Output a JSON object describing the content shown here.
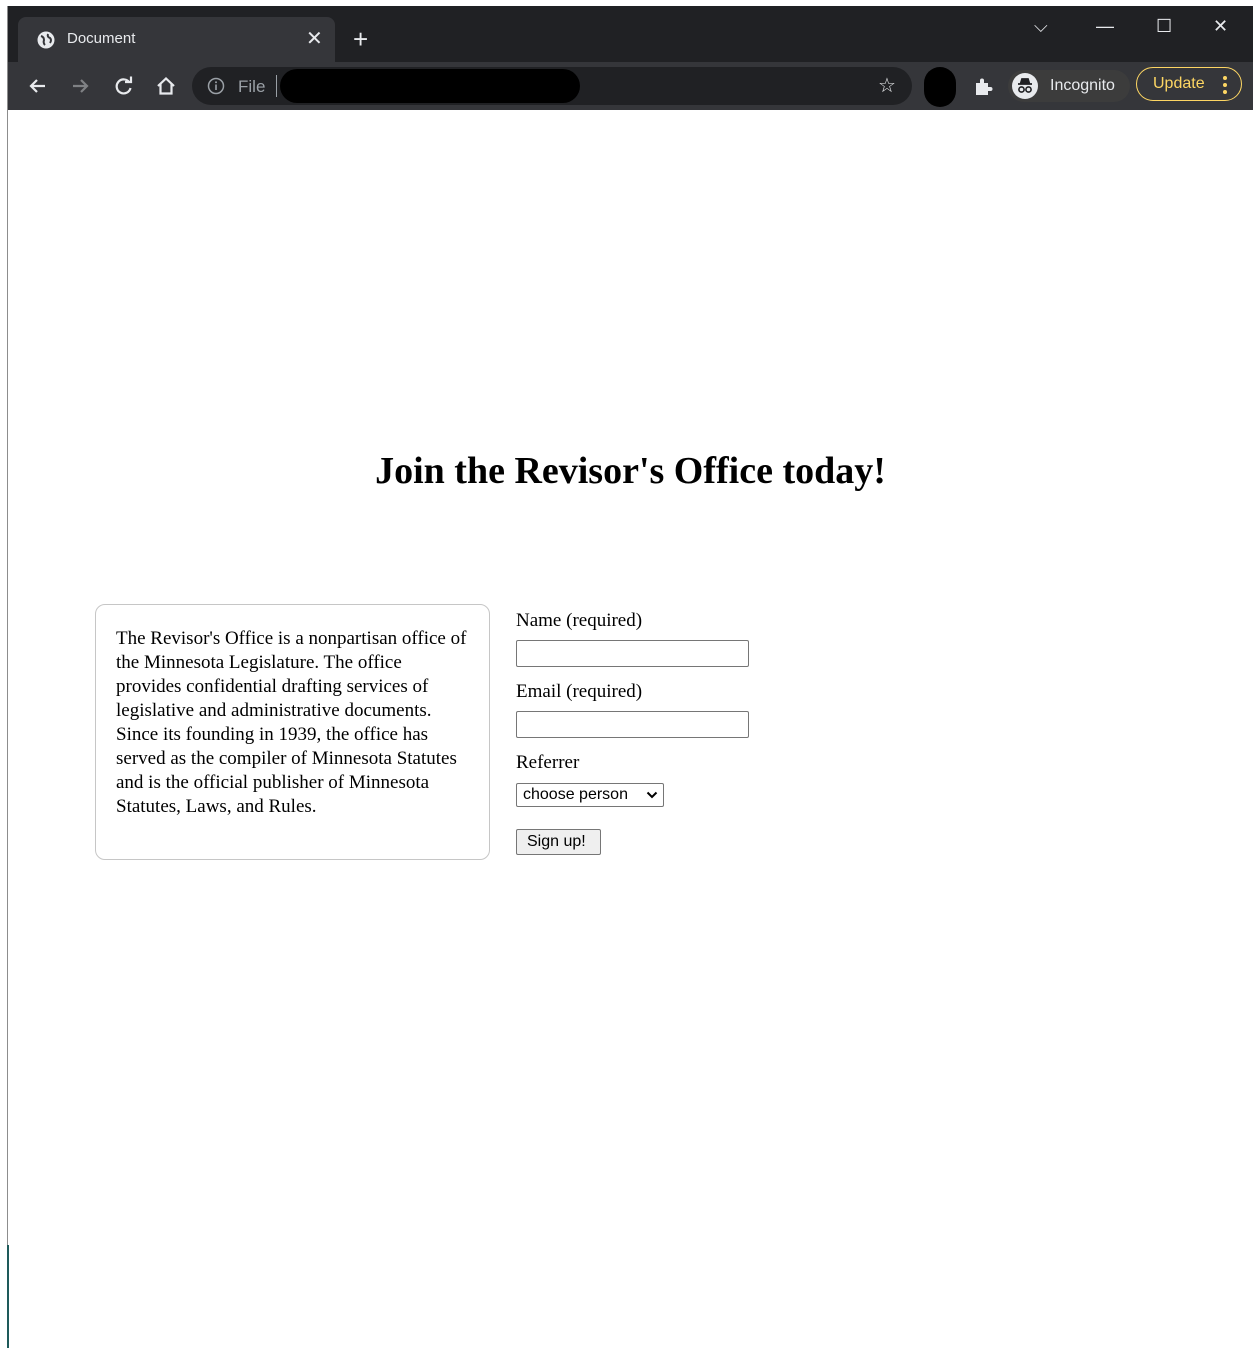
{
  "browser": {
    "tab_title": "Document",
    "tab_close": "✕",
    "new_tab": "+",
    "window_controls": {
      "tab_search": "⌵",
      "minimize": "—",
      "maximize": "☐",
      "close": "✕"
    },
    "address_scheme_label": "File",
    "bookmark_star": "☆",
    "incognito_label": "Incognito",
    "update_label": "Update",
    "colors": {
      "chrome_bg": "#202124",
      "toolbar_bg": "#35363a",
      "update_accent": "#fdd663"
    }
  },
  "page": {
    "heading": "Join the Revisor's Office today!",
    "info_text": "The Revisor's Office is a nonpartisan office of the Minnesota Legislature. The office provides confidential drafting services of legislative and administrative documents. Since its founding in 1939, the office has served as the compiler of Minnesota Statutes and is the official publisher of Minnesota Statutes, Laws, and Rules.",
    "form": {
      "name_label": "Name (required)",
      "name_value": "",
      "email_label": "Email (required)",
      "email_value": "",
      "referrer_label": "Referrer",
      "referrer_selected": "choose person",
      "submit_label": "Sign up!"
    }
  }
}
